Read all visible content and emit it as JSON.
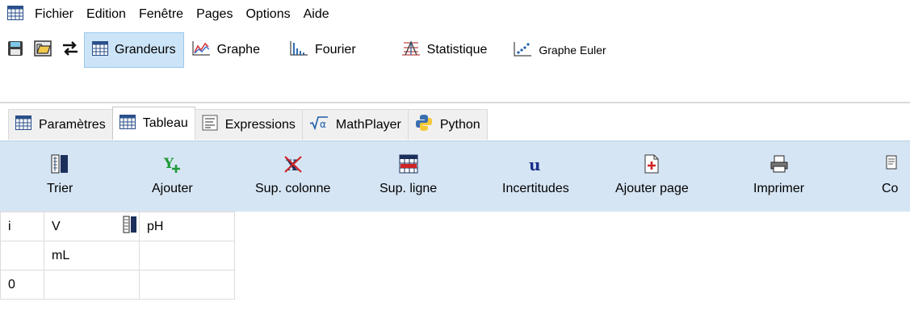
{
  "menubar": {
    "items": [
      "Fichier",
      "Edition",
      "Fenêtre",
      "Pages",
      "Options",
      "Aide"
    ]
  },
  "toolbar": {
    "grandeurs": "Grandeurs",
    "graphe": "Graphe",
    "fourier": "Fourier",
    "statistique": "Statistique",
    "graphe_euler": "Graphe Euler"
  },
  "tabs": [
    "Paramètres",
    "Tableau",
    "Expressions",
    "MathPlayer",
    "Python"
  ],
  "ribbon": {
    "trier": "Trier",
    "ajouter": "Ajouter",
    "sup_colonne": "Sup. colonne",
    "sup_ligne": "Sup. ligne",
    "incertitudes": "Incertitudes",
    "ajouter_page": "Ajouter page",
    "imprimer": "Imprimer",
    "copier": "Co"
  },
  "grid": {
    "header_index": "i",
    "col_v": "V",
    "col_ph": "pH",
    "unit_v": "mL",
    "unit_ph": "",
    "row0_index": "0",
    "row0_v": "",
    "row0_ph": ""
  },
  "colors": {
    "ribbon_bg": "#d6e5f4",
    "active_btn": "#cce4f7",
    "accent": "#1e5fa8"
  }
}
